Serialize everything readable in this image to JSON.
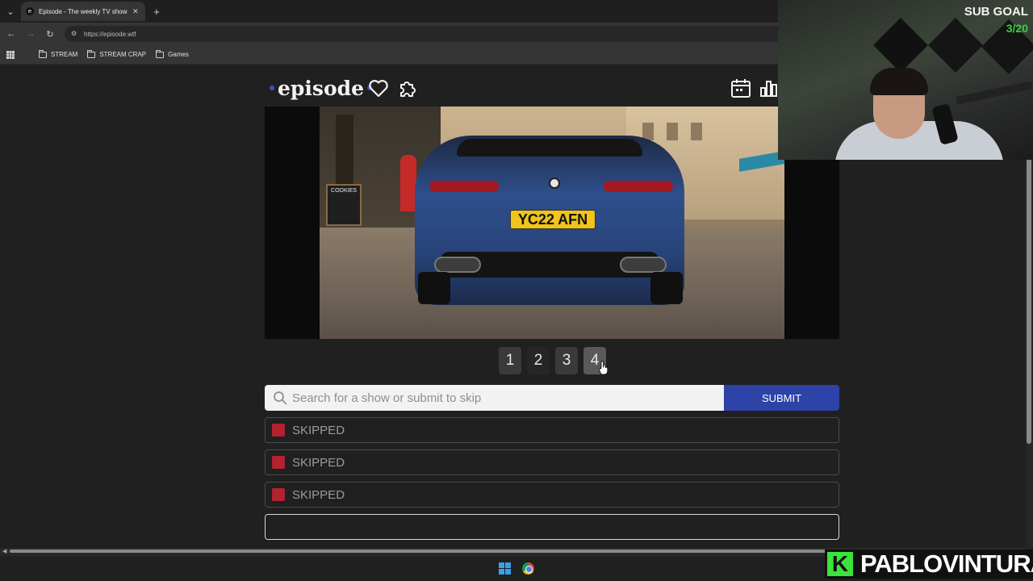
{
  "browser": {
    "tab_title": "Episode - The weekly TV show game",
    "tab_favicon": "e",
    "url": "https://episode.wtf",
    "bookmarks": [
      "STREAM",
      "STREAM CRAP",
      "Games"
    ]
  },
  "site": {
    "logo": "episode",
    "accent": "#3b52c4"
  },
  "clue_image": {
    "plate": "YC22 AFN",
    "sign": "COOKIES"
  },
  "pager": {
    "pages": [
      "1",
      "2",
      "3",
      "4"
    ]
  },
  "search": {
    "placeholder": "Search for a show or submit to skip",
    "value": "",
    "submit_label": "SUBMIT"
  },
  "guesses": [
    {
      "label": "SKIPPED",
      "status_color": "#b22231"
    },
    {
      "label": "SKIPPED",
      "status_color": "#b22231"
    },
    {
      "label": "SKIPPED",
      "status_color": "#b22231"
    },
    {
      "label": ""
    }
  ],
  "overlay": {
    "sub_goal_title": "SUB GOAL",
    "sub_goal_count": "3/20",
    "brand_letter": "K",
    "brand_name": "PABLOVINTURA"
  }
}
